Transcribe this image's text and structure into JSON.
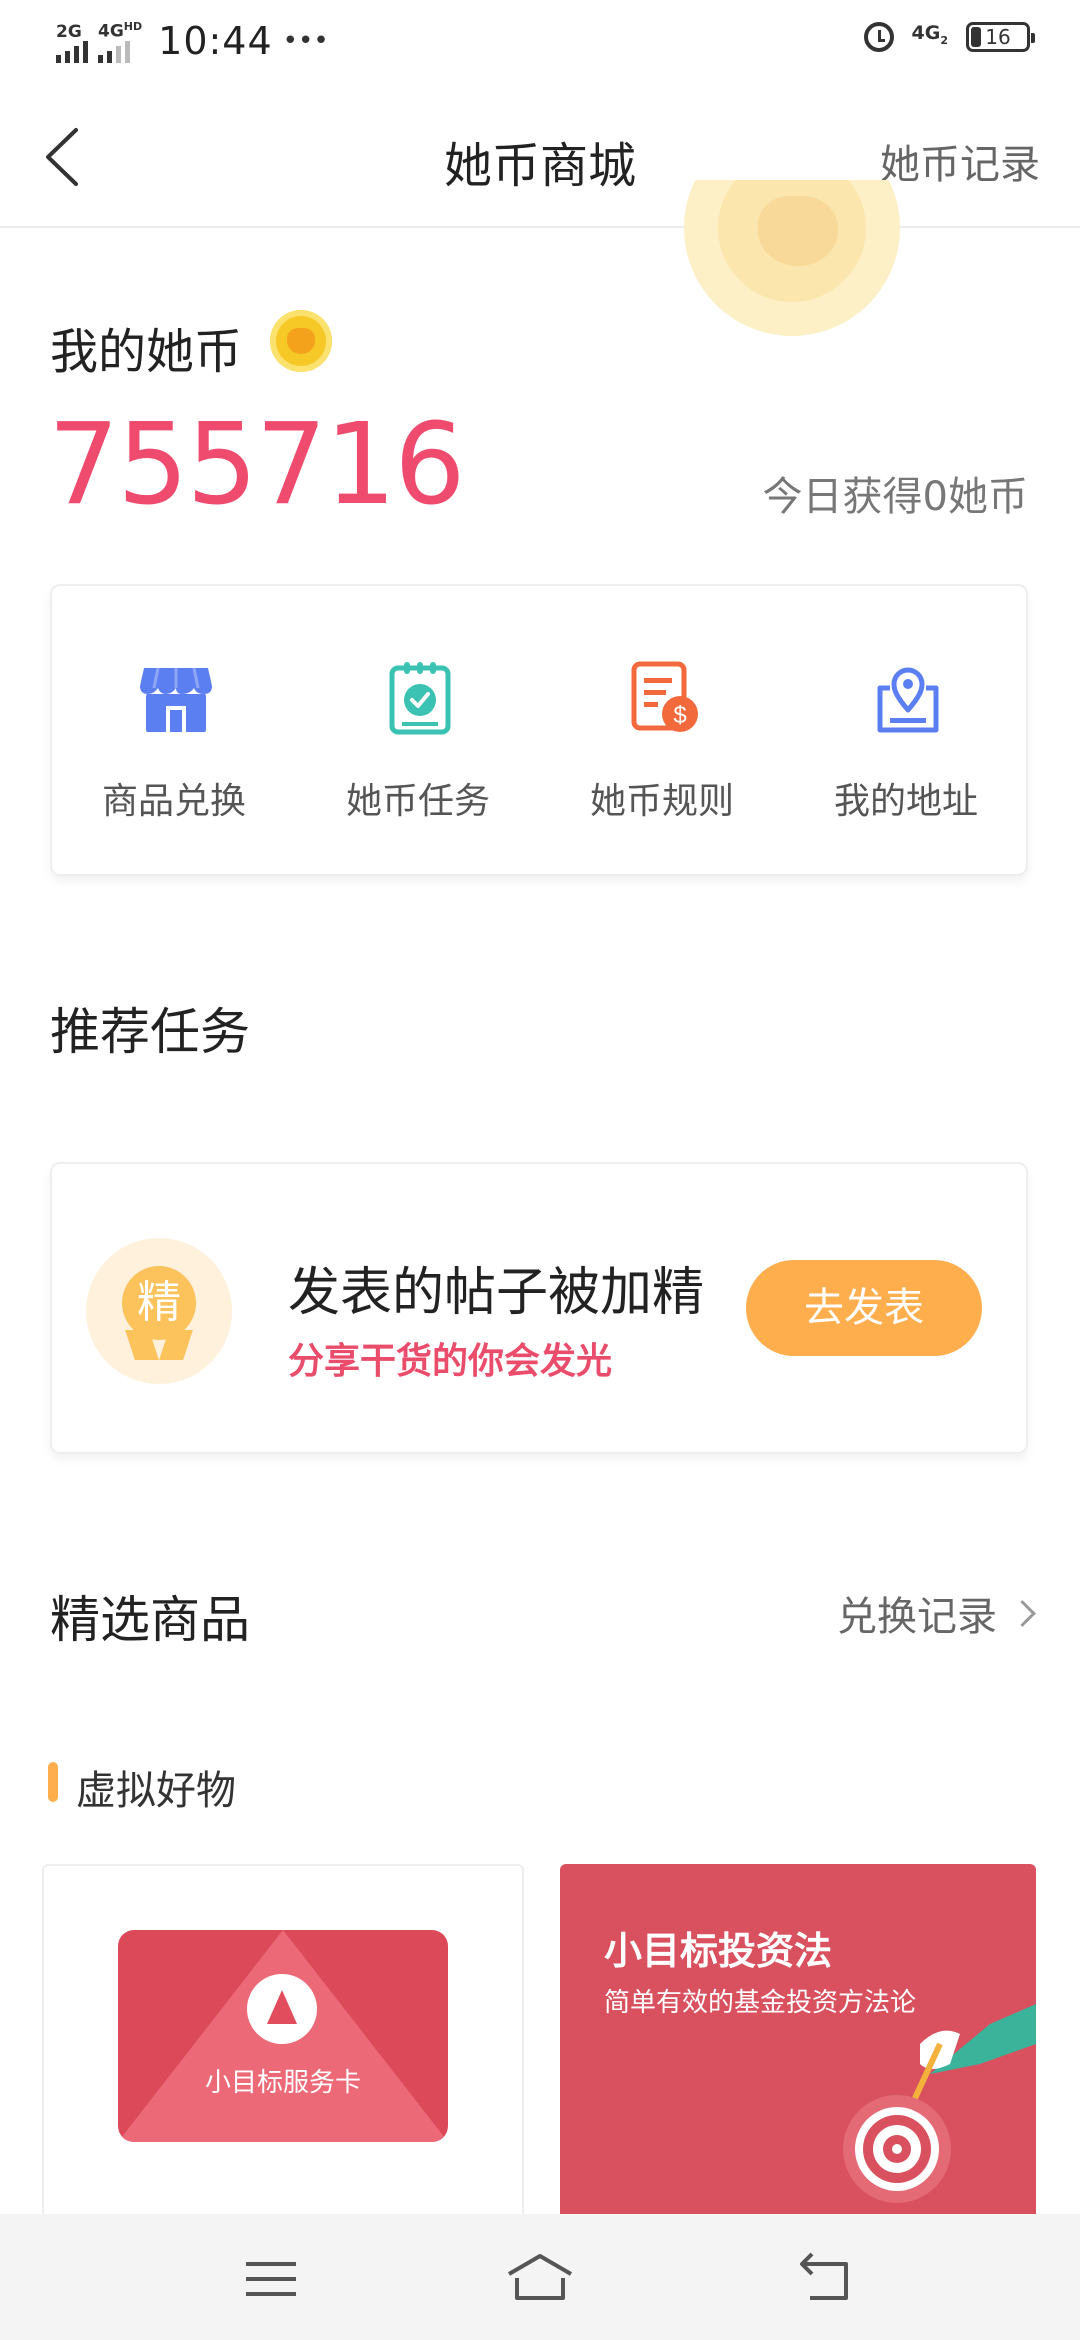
{
  "status_bar": {
    "signal1": "2G",
    "signal2": "4G",
    "signal2_sup": "HD",
    "time": "10:44",
    "more": "•••",
    "network": "4G",
    "network_sub": "2",
    "battery": "16"
  },
  "nav": {
    "title": "她币商城",
    "right_link": "她币记录"
  },
  "wallet": {
    "label": "我的她币",
    "amount": "755716",
    "today": "今日获得0她币"
  },
  "actions": [
    {
      "label": "商品兑换",
      "icon": "store-icon",
      "color": "#5b7ff0"
    },
    {
      "label": "她币任务",
      "icon": "task-clipboard-icon",
      "color": "#3cc2b3"
    },
    {
      "label": "她币规则",
      "icon": "rules-document-icon",
      "color": "#f26a3b"
    },
    {
      "label": "我的地址",
      "icon": "location-icon",
      "color": "#5b7ff0"
    }
  ],
  "recommended": {
    "section_title": "推荐任务",
    "task": {
      "badge_text": "精",
      "title": "发表的帖子被加精",
      "subtitle": "分享干货的你会发光",
      "button": "去发表"
    }
  },
  "featured": {
    "section_title": "精选商品",
    "exchange_link": "兑换记录",
    "category": "虚拟好物",
    "products": [
      {
        "card_label": "小目标服务卡"
      },
      {
        "title": "小目标投资法",
        "subtitle": "简单有效的基金投资方法论"
      }
    ]
  },
  "colors": {
    "accent_red": "#ef4b6e",
    "accent_orange": "#ffae4d"
  }
}
